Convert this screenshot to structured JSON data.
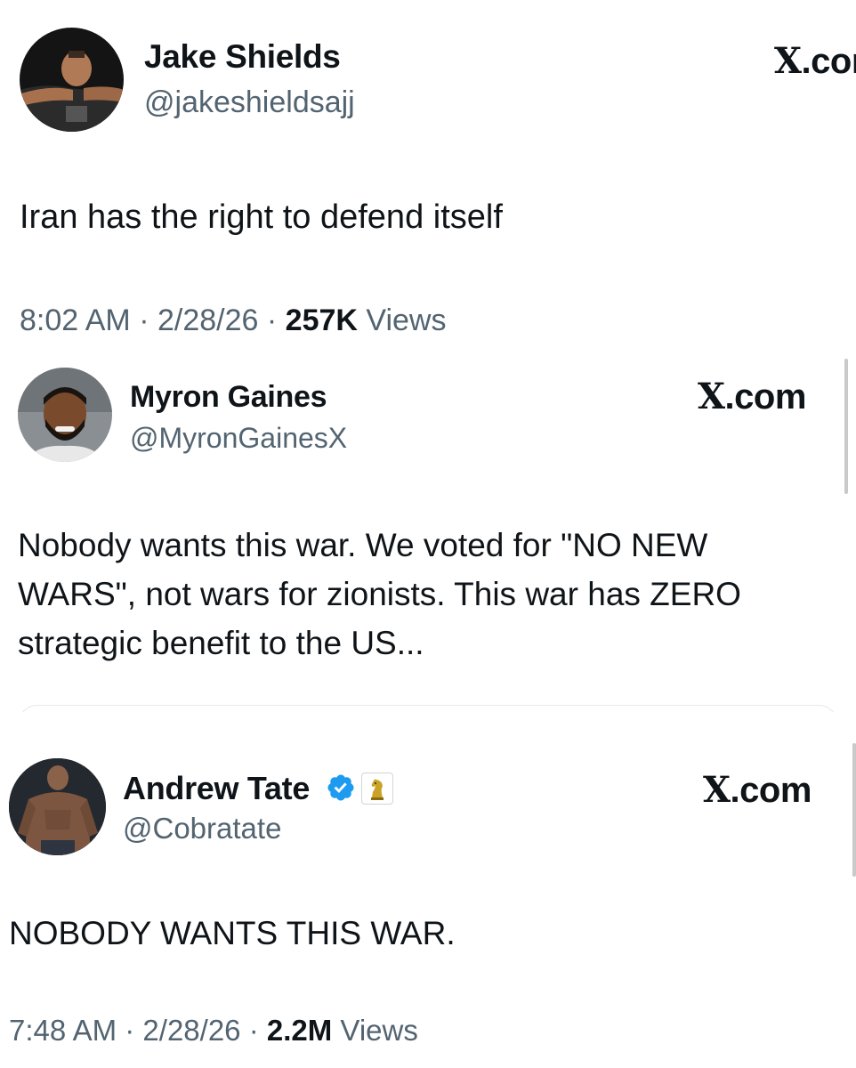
{
  "tweets": [
    {
      "author": {
        "name": "Jake Shields",
        "handle": "@jakeshieldsajj"
      },
      "brand": {
        "x": "X",
        "rest": ".com"
      },
      "text": "Iran has the right to defend itself",
      "meta": {
        "time": "8:02 AM",
        "sep": "·",
        "date": "2/28/26",
        "views_count": "257K",
        "views_label": "Views"
      }
    },
    {
      "author": {
        "name": "Myron Gaines",
        "handle": "@MyronGainesX"
      },
      "brand": {
        "x": "X",
        "rest": ".com"
      },
      "text": "Nobody wants this war. We voted for \"NO NEW\nWARS\", not wars for zionists. This war has ZERO\nstrategic benefit to the US..."
    },
    {
      "author": {
        "name": "Andrew Tate",
        "handle": "@Cobratate"
      },
      "brand": {
        "x": "X",
        "rest": ".com"
      },
      "text": "NOBODY WANTS THIS WAR.",
      "meta": {
        "time": "7:48 AM",
        "sep": "·",
        "date": "2/28/26",
        "views_count": "2.2M",
        "views_label": "Views"
      }
    }
  ],
  "icons": {
    "verified": "verified-badge-icon",
    "affiliate": "chess-knight-icon",
    "verified_color": "#1d9bf0",
    "affiliate_color": "#c9a227"
  }
}
